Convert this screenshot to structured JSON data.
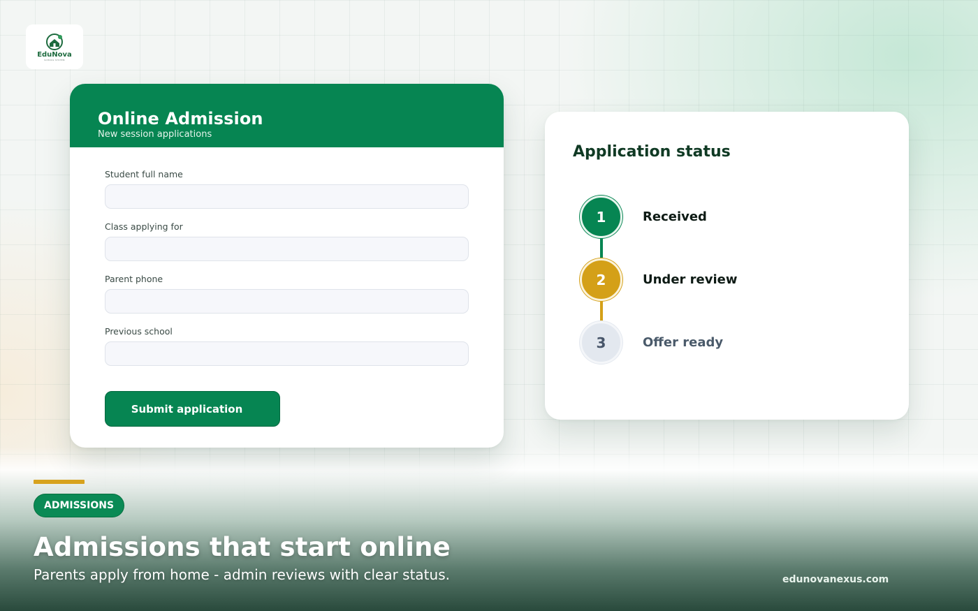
{
  "brand": {
    "logo_name": "EduNova",
    "logo_tagline": "SCHOOL SYSTEM",
    "website": "edunovanexus.com"
  },
  "admission_form": {
    "title": "Online Admission",
    "subtitle": "New session applications",
    "fields": [
      {
        "label": "Student full name",
        "value": "",
        "placeholder": ""
      },
      {
        "label": "Class applying for",
        "value": "",
        "placeholder": ""
      },
      {
        "label": "Parent phone",
        "value": "",
        "placeholder": ""
      },
      {
        "label": "Previous school",
        "value": "",
        "placeholder": ""
      }
    ],
    "submit_label": "Submit application"
  },
  "status_panel": {
    "title": "Application status",
    "steps": [
      {
        "number": "1",
        "label": "Received",
        "state": "complete"
      },
      {
        "number": "2",
        "label": "Under review",
        "state": "current"
      },
      {
        "number": "3",
        "label": "Offer ready",
        "state": "pending"
      }
    ]
  },
  "promo": {
    "badge": "ADMISSIONS",
    "headline": "Admissions that start online",
    "subheadline": "Parents apply from home - admin reviews with clear status."
  },
  "colors": {
    "brand_green": "#068552",
    "review_gold": "#d4a018",
    "pending_gray": "#e3e8ef",
    "accent_gold": "#d7a21d"
  }
}
